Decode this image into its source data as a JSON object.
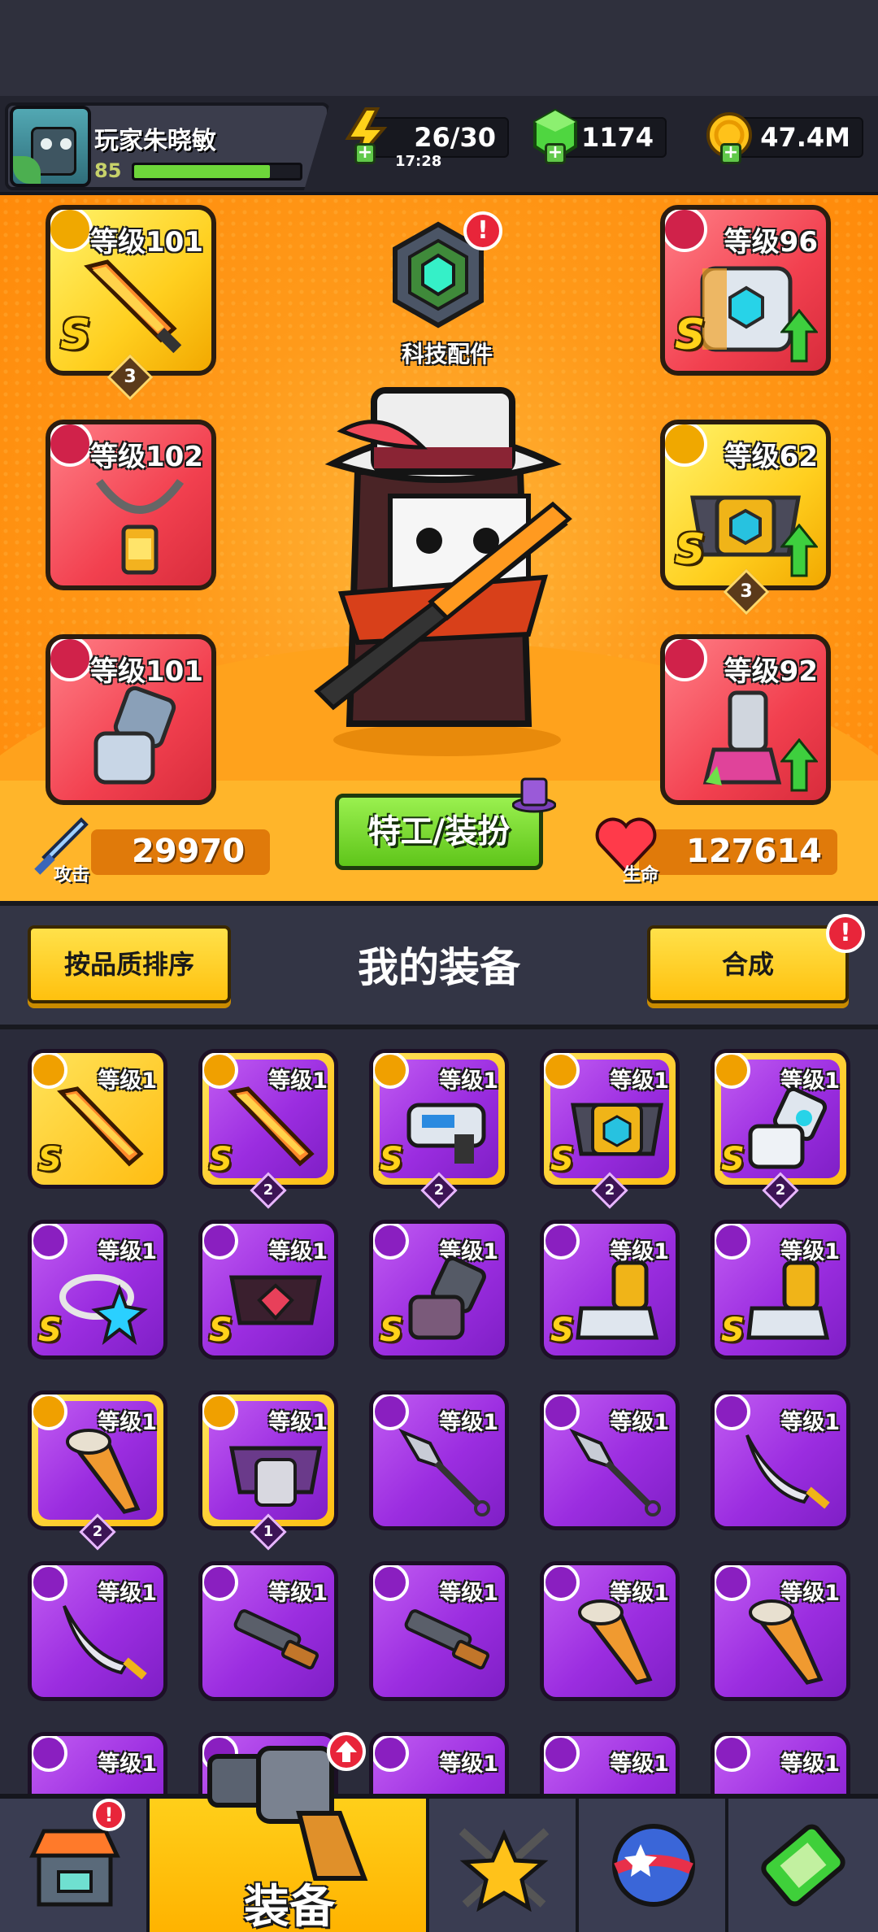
{
  "player": {
    "name": "玩家朱晓敏",
    "level": "85",
    "xp_fraction": 0.82
  },
  "resources": {
    "energy": "26/30",
    "energy_timer": "17:28",
    "gems": "1174",
    "gold": "47.4M"
  },
  "equipped": {
    "weapon": {
      "level_label": "等级101",
      "grade": "S",
      "rank": "3"
    },
    "necklace": {
      "level_label": "等级102"
    },
    "gloves": {
      "level_label": "等级101"
    },
    "armor": {
      "level_label": "等级96",
      "grade": "S"
    },
    "belt": {
      "level_label": "等级62",
      "grade": "S",
      "rank": "3"
    },
    "boots": {
      "level_label": "等级92"
    }
  },
  "tech": {
    "label": "科技配件",
    "badge": "!"
  },
  "costume_button": "特工/装扮",
  "stats": {
    "attack_label": "攻击",
    "attack_value": "29970",
    "hp_label": "生命",
    "hp_value": "127614"
  },
  "equipment_panel": {
    "sort_button": "按品质排序",
    "title": "我的装备",
    "merge_button": "合成",
    "merge_badge": "!"
  },
  "inventory": {
    "level_label": "等级1",
    "grade": "S",
    "row1_ranks": [
      "",
      "2",
      "2",
      "2",
      "2"
    ],
    "row3_ranks": [
      "2",
      "1"
    ]
  },
  "bottom_nav": {
    "equip_label": "装备",
    "shop_badge": "!"
  },
  "colors": {
    "hero_bg": "#ff9a1a",
    "gold_frame": "#ffcf1f",
    "red_frame": "#f2404f",
    "purple_frame": "#9b2de0",
    "green_button": "#6dd63a"
  }
}
